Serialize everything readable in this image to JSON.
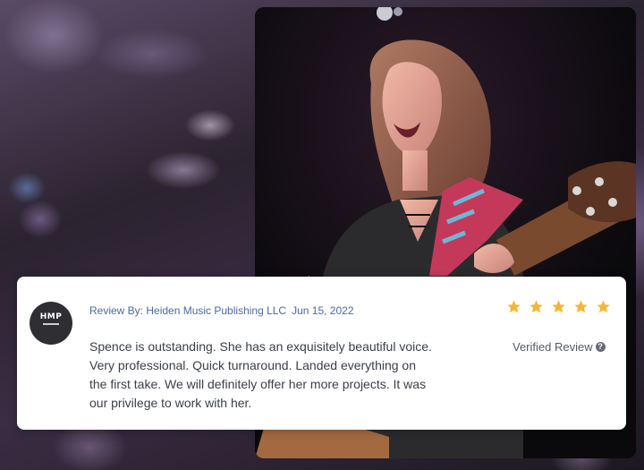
{
  "review": {
    "byline": "Review By: Heiden Music Publishing LLC",
    "date": "Jun 15, 2022",
    "text": "Spence is outstanding. She has an exquisitely beautiful voice. Very professional. Quick turnaround. Landed everything on the first take. We will definitely offer her more projects. It was our privilege to work with her.",
    "verified": "Verified Review",
    "verified_help_icon": "?",
    "rating": 5,
    "max_rating": 5,
    "star_color": "#f5b731"
  },
  "avatar": {
    "initials": "HMP"
  },
  "colors": {
    "byline": "#4a69a8",
    "text": "#3a3f47"
  },
  "icons": [
    "star-icon",
    "help-circle-icon"
  ]
}
